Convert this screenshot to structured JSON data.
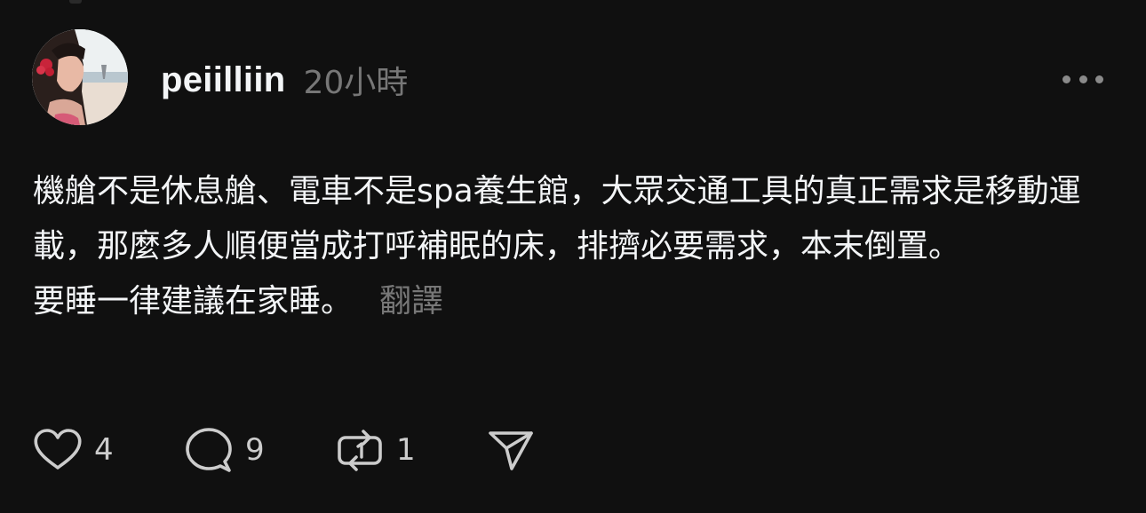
{
  "post": {
    "username": "peiilliin",
    "timestamp": "20小時",
    "body_lines": [
      "機艙不是休息艙、電車不是spa養生館，大眾交通工具的真正需求是移動運載，那麼多人順便當成打呼補眠的床，排擠必要需求，本末倒置。",
      "要睡一律建議在家睡。"
    ],
    "translate_label": "翻譯"
  },
  "actions": {
    "like_count": "4",
    "reply_count": "9",
    "repost_count": "1"
  },
  "icons": {
    "more": "more-horizontal-icon",
    "like": "heart-icon",
    "reply": "speech-bubble-icon",
    "repost": "repost-arrows-icon",
    "share": "send-icon"
  },
  "colors": {
    "background": "#101010",
    "primary_text": "#f3f5f7",
    "secondary_text": "#777777"
  }
}
